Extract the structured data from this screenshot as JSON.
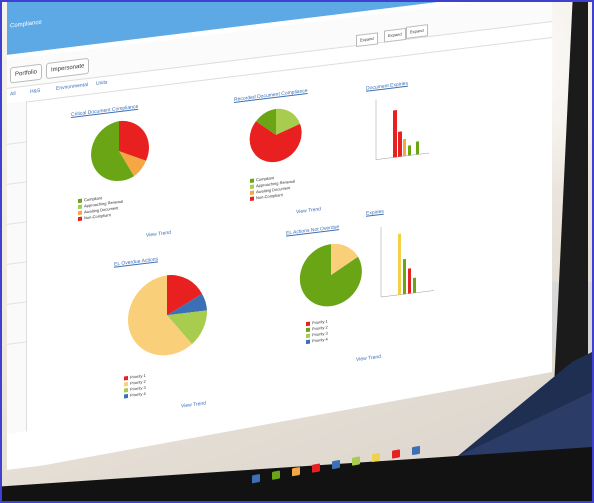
{
  "app": {
    "title": "Compliance",
    "toolbar": {
      "portfolio_label": "Portfolio",
      "impersonate_label": "Impersonate"
    },
    "tabs": [
      "All",
      "H&S",
      "Environmental",
      "Units"
    ],
    "right_buttons": [
      "Expand",
      "Expand",
      "Expand"
    ]
  },
  "charts": [
    {
      "title": "Critical Document Compliance",
      "legend": [
        "Compliant",
        "Approaching Renewal",
        "Awaiting Document",
        "Non-Compliant"
      ],
      "values": [],
      "trend_link": "View Trend"
    },
    {
      "title": "Recorded Document Compliance",
      "legend": [
        "Compliant",
        "Approaching Renewal",
        "Awaiting Document",
        "Non-Compliant"
      ],
      "values": [],
      "trend_link": "View Trend"
    },
    {
      "title": "EL Overdue Actions",
      "legend": [
        "Priority 1",
        "Priority 2",
        "Priority 3",
        "Priority 4"
      ],
      "values": [],
      "trend_link": "View Trend"
    },
    {
      "title": "EL Actions Not Overdue",
      "legend": [
        "Priority 1",
        "Priority 2",
        "Priority 3",
        "Priority 4"
      ],
      "values": [],
      "trend_link": "View Trend"
    }
  ],
  "right_panel": {
    "top_title": "Document Expiries",
    "bottom_title": "Expiries"
  },
  "colors": {
    "topbar": "#5da9e6",
    "green": "#6aa516",
    "light_green": "#a8cc4e",
    "orange": "#f4a742",
    "red": "#e82020",
    "peach": "#f9cf7a",
    "blue": "#3b6fb6",
    "yellow": "#f2d14a"
  }
}
